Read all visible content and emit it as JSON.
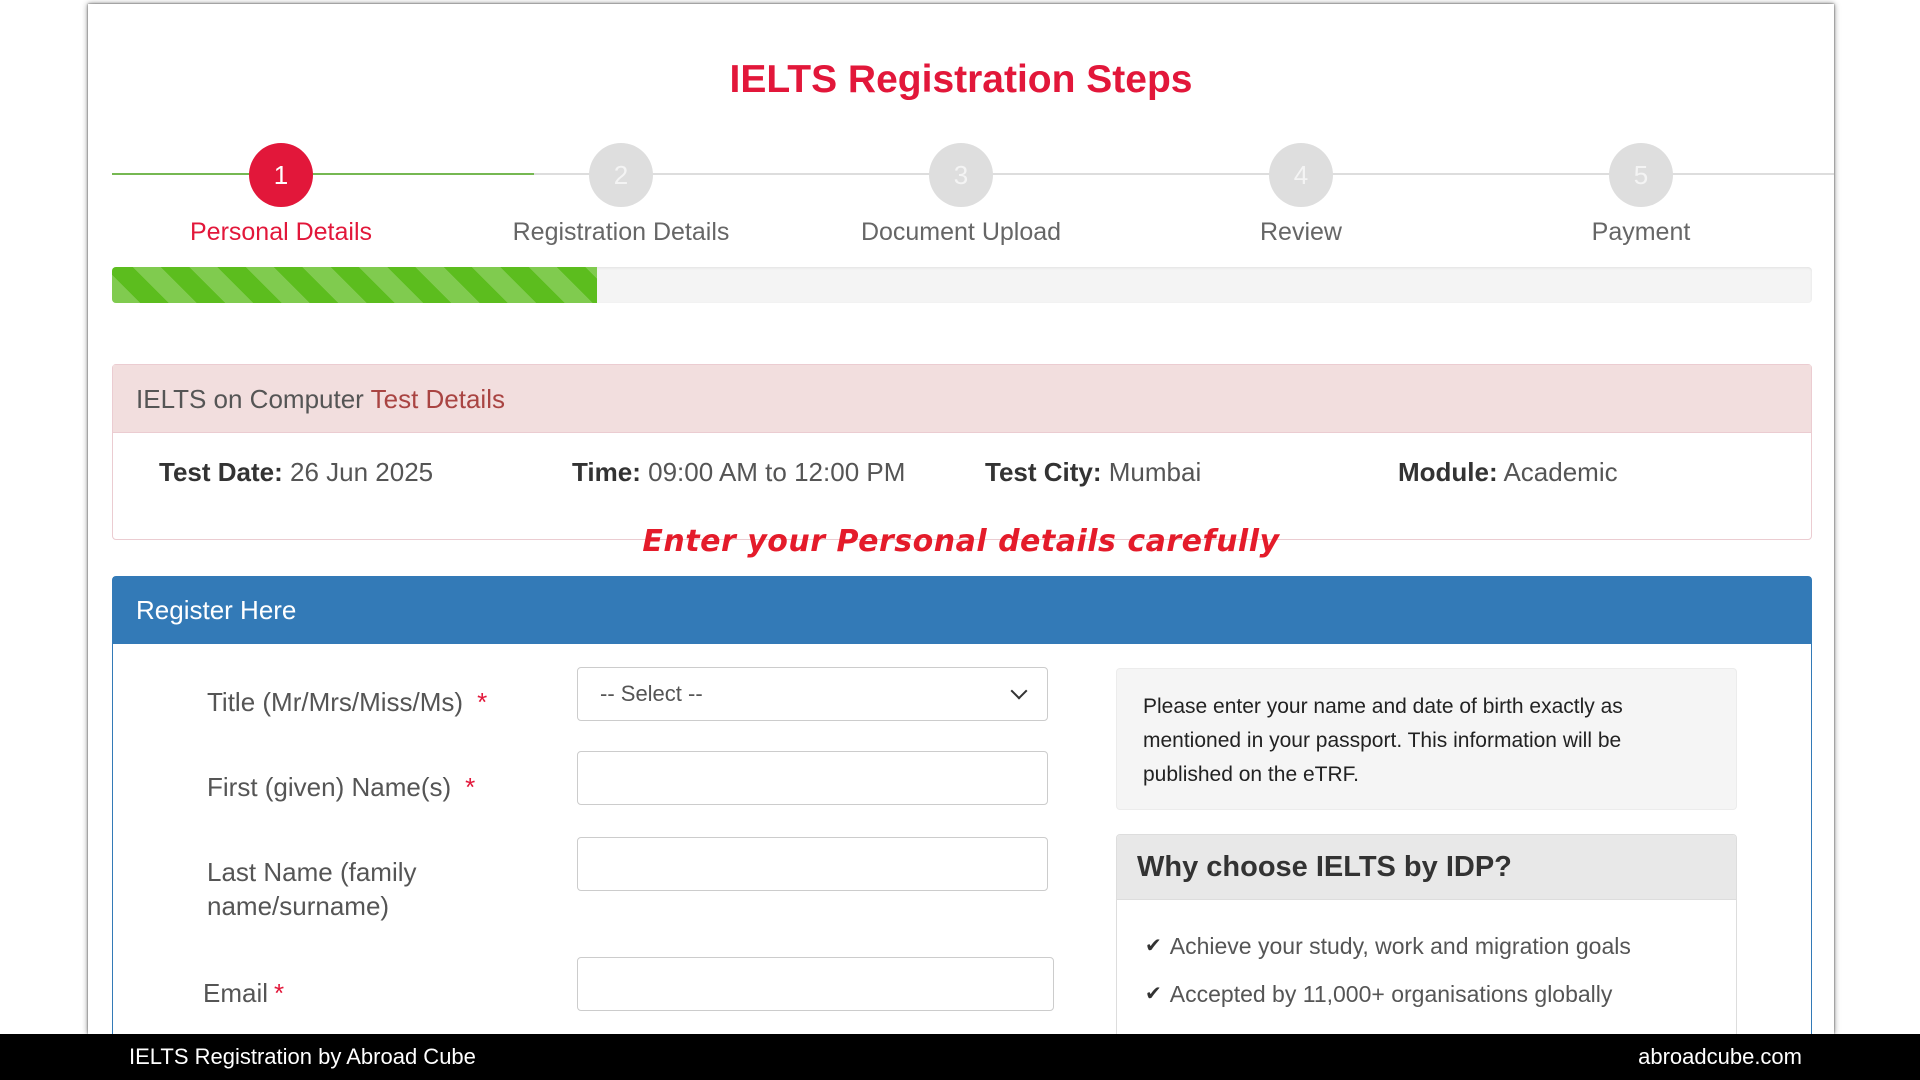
{
  "page_title": "IELTS Registration Steps",
  "steps": [
    {
      "number": "1",
      "label": "Personal Details",
      "active": true
    },
    {
      "number": "2",
      "label": "Registration Details",
      "active": false
    },
    {
      "number": "3",
      "label": "Document Upload",
      "active": false
    },
    {
      "number": "4",
      "label": "Review",
      "active": false
    },
    {
      "number": "5",
      "label": "Payment",
      "active": false
    }
  ],
  "progress": {
    "percent": 28.5,
    "color": "#5cbd1e"
  },
  "test_details": {
    "heading_prefix": "IELTS on Computer",
    "heading_accent": "Test Details",
    "date_label": "Test Date:",
    "date_value": "26 Jun 2025",
    "time_label": "Time:",
    "time_value": "09:00 AM to 12:00 PM",
    "city_label": "Test City:",
    "city_value": "Mumbai",
    "module_label": "Module:",
    "module_value": "Academic"
  },
  "annotation": "Enter your Personal details carefully",
  "register": {
    "heading": "Register Here",
    "fields": {
      "title": {
        "label": "Title (Mr/Mrs/Miss/Ms)",
        "required": "*",
        "selected": "-- Select --"
      },
      "first_name": {
        "label": "First (given) Name(s)",
        "required": "*",
        "value": ""
      },
      "last_name": {
        "label_line1": "Last Name (family",
        "label_line2": "name/surname)",
        "value": ""
      },
      "email": {
        "label": "Email",
        "required": "*",
        "value": ""
      }
    },
    "note": "Please enter your name and date of birth exactly as mentioned in your passport. This information will be published on the eTRF.",
    "why": {
      "title": "Why choose IELTS by IDP?",
      "items": [
        "Achieve your study, work and migration goals",
        "Accepted by 11,000+ organisations globally"
      ]
    }
  },
  "footer": {
    "left": "IELTS Registration by Abroad Cube",
    "right": "abroadcube.com"
  },
  "colors": {
    "accent_red": "#e2173a",
    "panel_blue": "#337ab7",
    "success_green": "#76b852"
  }
}
